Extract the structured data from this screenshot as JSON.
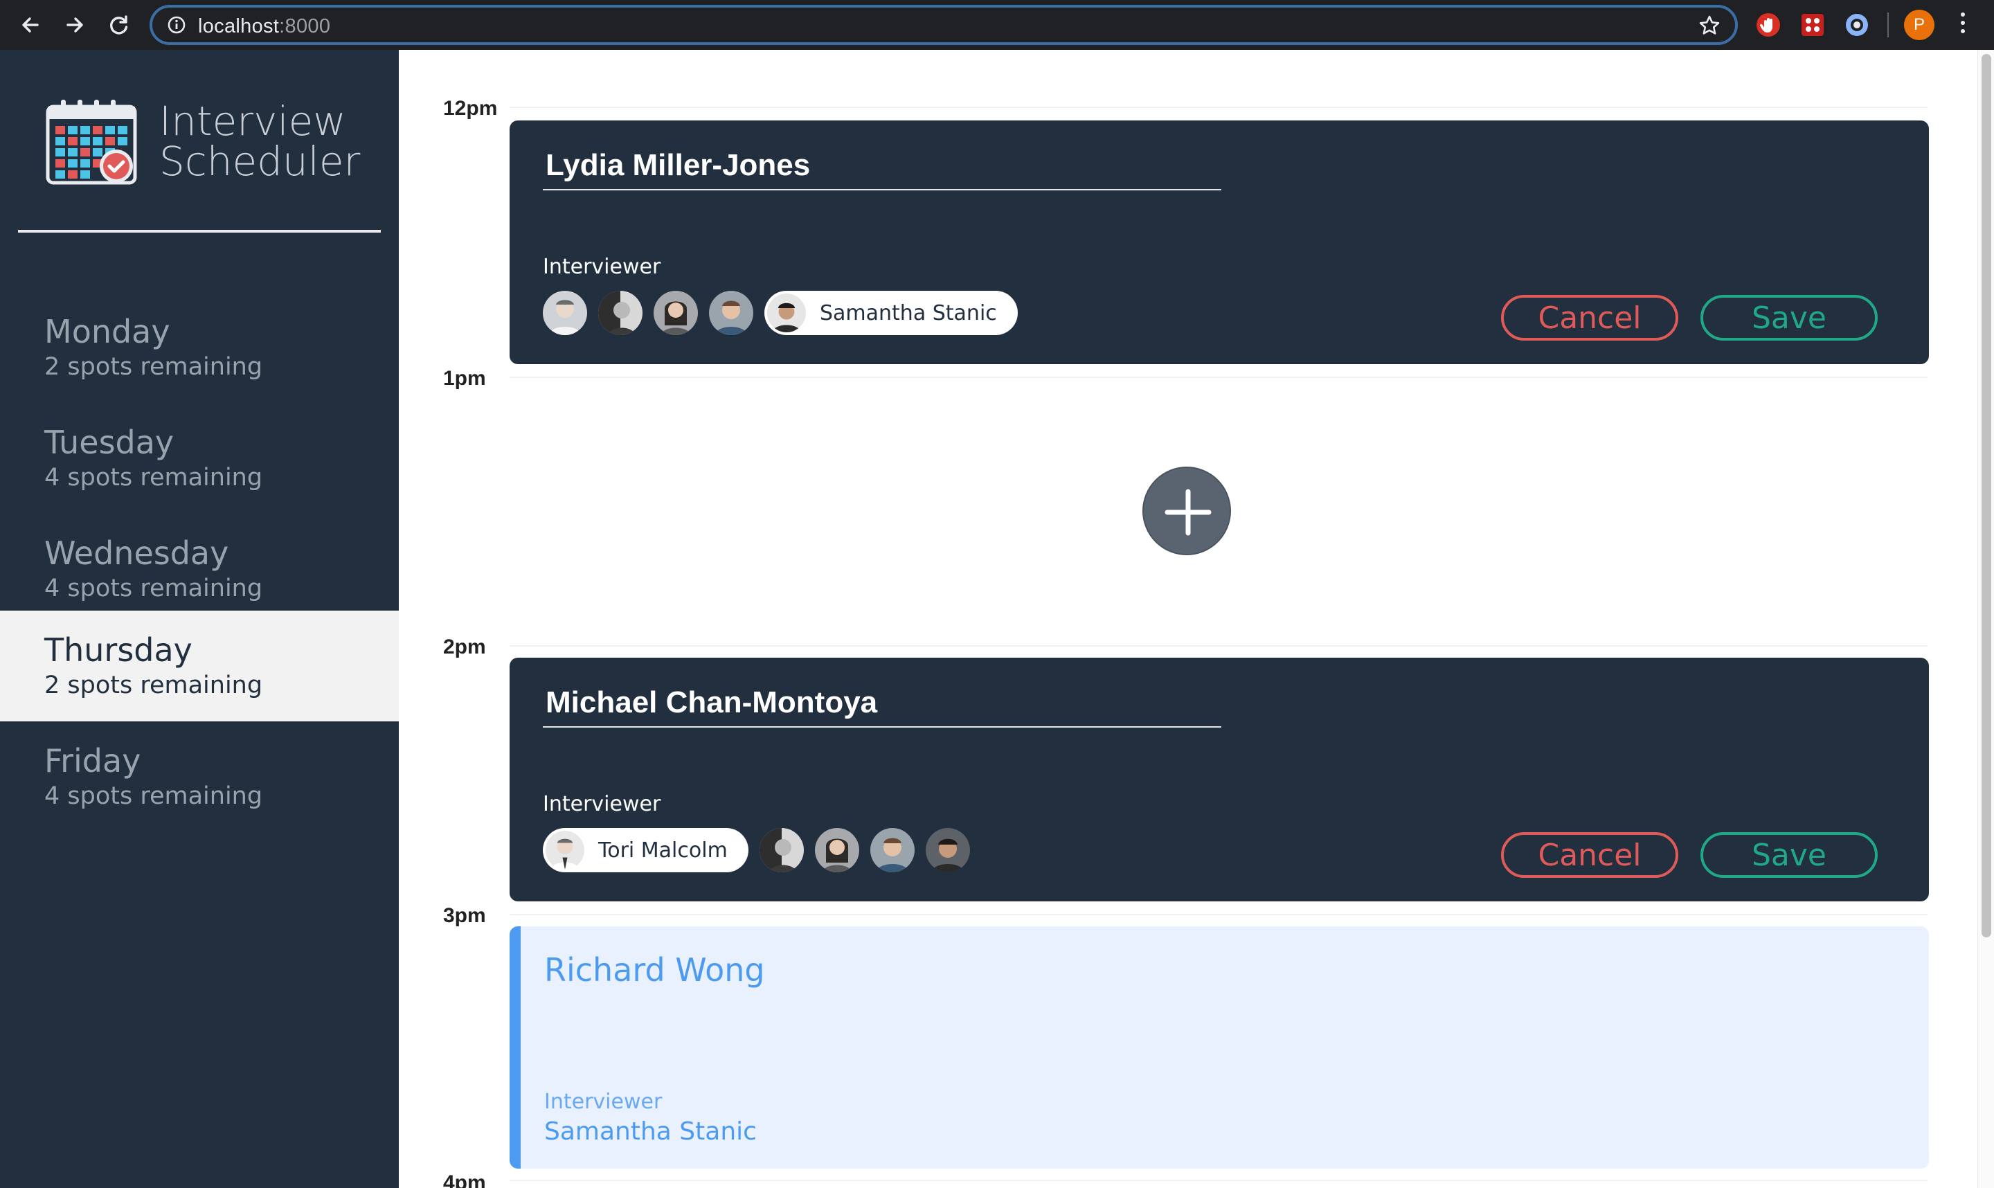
{
  "browser": {
    "url_host": "localhost",
    "url_port": ":8000",
    "profile_initial": "P"
  },
  "app": {
    "title_line1": "Interview",
    "title_line2": "Scheduler"
  },
  "days": [
    {
      "name": "Monday",
      "spots": "2 spots remaining"
    },
    {
      "name": "Tuesday",
      "spots": "4 spots remaining"
    },
    {
      "name": "Wednesday",
      "spots": "4 spots remaining"
    },
    {
      "name": "Thursday",
      "spots": "2 spots remaining",
      "selected": true
    },
    {
      "name": "Friday",
      "spots": "4 spots remaining"
    }
  ],
  "times": [
    "12pm",
    "1pm",
    "2pm",
    "3pm",
    "4pm"
  ],
  "appointments": {
    "first": {
      "student": "Lydia Miller-Jones",
      "interviewer_label": "Interviewer",
      "selected_interviewer": "Samantha Stanic",
      "cancel": "Cancel",
      "save": "Save"
    },
    "second": {
      "student": "Michael Chan-Montoya",
      "interviewer_label": "Interviewer",
      "selected_interviewer": "Tori Malcolm",
      "cancel": "Cancel",
      "save": "Save"
    },
    "third": {
      "student": "Richard Wong",
      "interviewer_label": "Interviewer",
      "interviewer": "Samantha Stanic"
    }
  },
  "colors": {
    "sidebar_bg": "#222f3e",
    "cancel": "#e05a5a",
    "save": "#21a887",
    "show_accent": "#4d9bf0"
  }
}
